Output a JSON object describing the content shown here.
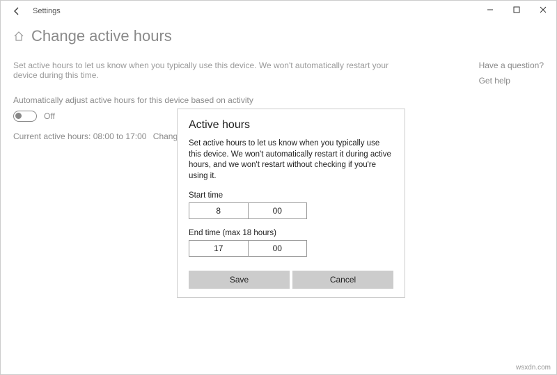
{
  "window": {
    "title": "Settings"
  },
  "page": {
    "title": "Change active hours",
    "description": "Set active hours to let us know when you typically use this device. We won't automatically restart your device during this time.",
    "auto_adjust_label": "Automatically adjust active hours for this device based on activity",
    "toggle_state": "Off",
    "current_prefix": "Current active hours: ",
    "current_value": "08:00 to 17:00",
    "change_link": "Change"
  },
  "sidebar": {
    "question": "Have a question?",
    "help": "Get help"
  },
  "dialog": {
    "title": "Active hours",
    "description": "Set active hours to let us know when you typically use this device. We won't automatically restart it during active hours, and we won't restart without checking if you're using it.",
    "start_label": "Start time",
    "start_hour": "8",
    "start_minute": "00",
    "end_label": "End time (max 18 hours)",
    "end_hour": "17",
    "end_minute": "00",
    "save": "Save",
    "cancel": "Cancel"
  },
  "watermark": "wsxdn.com"
}
